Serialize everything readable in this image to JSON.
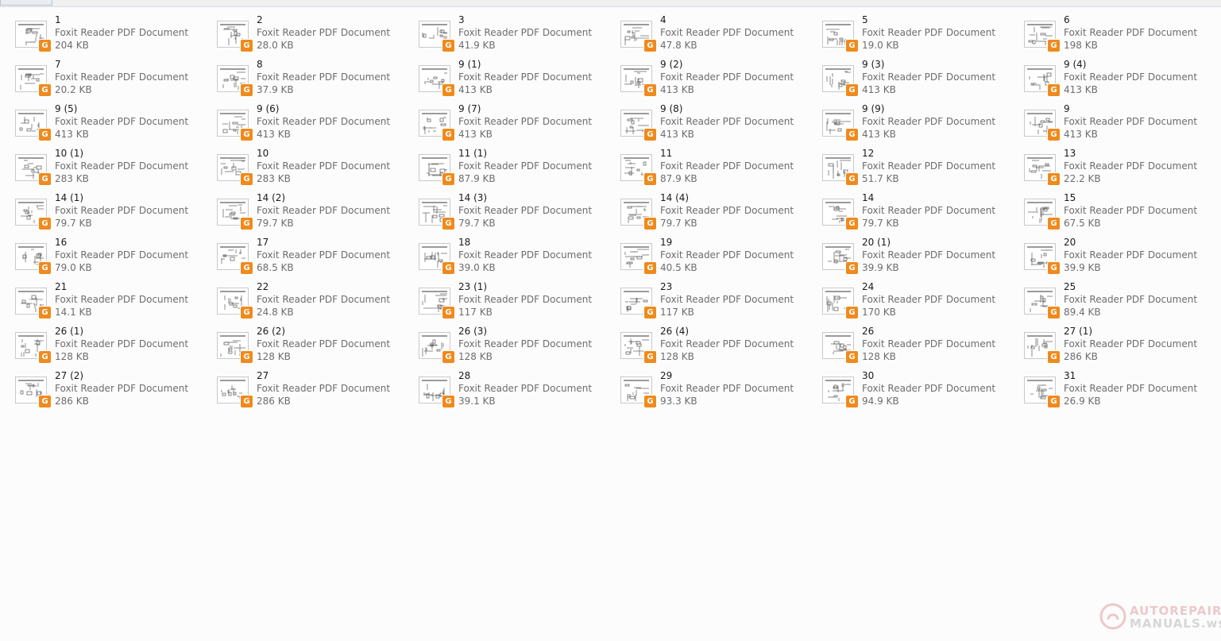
{
  "file_type": "Foxit Reader PDF Document",
  "badge_glyph": "G",
  "files": [
    {
      "name": "1",
      "size": "204 KB"
    },
    {
      "name": "2",
      "size": "28.0 KB"
    },
    {
      "name": "3",
      "size": "41.9 KB"
    },
    {
      "name": "4",
      "size": "47.8 KB"
    },
    {
      "name": "5",
      "size": "19.0 KB"
    },
    {
      "name": "6",
      "size": "198 KB"
    },
    {
      "name": "7",
      "size": "20.2 KB"
    },
    {
      "name": "8",
      "size": "37.9 KB"
    },
    {
      "name": "9 (1)",
      "size": "413 KB"
    },
    {
      "name": "9 (2)",
      "size": "413 KB"
    },
    {
      "name": "9 (3)",
      "size": "413 KB"
    },
    {
      "name": "9 (4)",
      "size": "413 KB"
    },
    {
      "name": "9 (5)",
      "size": "413 KB"
    },
    {
      "name": "9 (6)",
      "size": "413 KB"
    },
    {
      "name": "9 (7)",
      "size": "413 KB"
    },
    {
      "name": "9 (8)",
      "size": "413 KB"
    },
    {
      "name": "9 (9)",
      "size": "413 KB"
    },
    {
      "name": "9",
      "size": "413 KB"
    },
    {
      "name": "10 (1)",
      "size": "283 KB"
    },
    {
      "name": "10",
      "size": "283 KB"
    },
    {
      "name": "11 (1)",
      "size": "87.9 KB"
    },
    {
      "name": "11",
      "size": "87.9 KB"
    },
    {
      "name": "12",
      "size": "51.7 KB"
    },
    {
      "name": "13",
      "size": "22.2 KB"
    },
    {
      "name": "14 (1)",
      "size": "79.7 KB"
    },
    {
      "name": "14 (2)",
      "size": "79.7 KB"
    },
    {
      "name": "14 (3)",
      "size": "79.7 KB"
    },
    {
      "name": "14 (4)",
      "size": "79.7 KB"
    },
    {
      "name": "14",
      "size": "79.7 KB"
    },
    {
      "name": "15",
      "size": "67.5 KB"
    },
    {
      "name": "16",
      "size": "79.0 KB"
    },
    {
      "name": "17",
      "size": "68.5 KB"
    },
    {
      "name": "18",
      "size": "39.0 KB"
    },
    {
      "name": "19",
      "size": "40.5 KB"
    },
    {
      "name": "20 (1)",
      "size": "39.9 KB"
    },
    {
      "name": "20",
      "size": "39.9 KB"
    },
    {
      "name": "21",
      "size": "14.1 KB"
    },
    {
      "name": "22",
      "size": "24.8 KB"
    },
    {
      "name": "23 (1)",
      "size": "117 KB"
    },
    {
      "name": "23",
      "size": "117 KB"
    },
    {
      "name": "24",
      "size": "170 KB"
    },
    {
      "name": "25",
      "size": "89.4 KB"
    },
    {
      "name": "26 (1)",
      "size": "128 KB"
    },
    {
      "name": "26 (2)",
      "size": "128 KB"
    },
    {
      "name": "26 (3)",
      "size": "128 KB"
    },
    {
      "name": "26 (4)",
      "size": "128 KB"
    },
    {
      "name": "26",
      "size": "128 KB"
    },
    {
      "name": "27 (1)",
      "size": "286 KB"
    },
    {
      "name": "27 (2)",
      "size": "286 KB"
    },
    {
      "name": "27",
      "size": "286 KB"
    },
    {
      "name": "28",
      "size": "39.1 KB"
    },
    {
      "name": "29",
      "size": "93.3 KB"
    },
    {
      "name": "30",
      "size": "94.9 KB"
    },
    {
      "name": "31",
      "size": "26.9 KB"
    }
  ],
  "watermark": {
    "line1": "AUTOREPAIR",
    "line2": "MANUALS.ws"
  }
}
